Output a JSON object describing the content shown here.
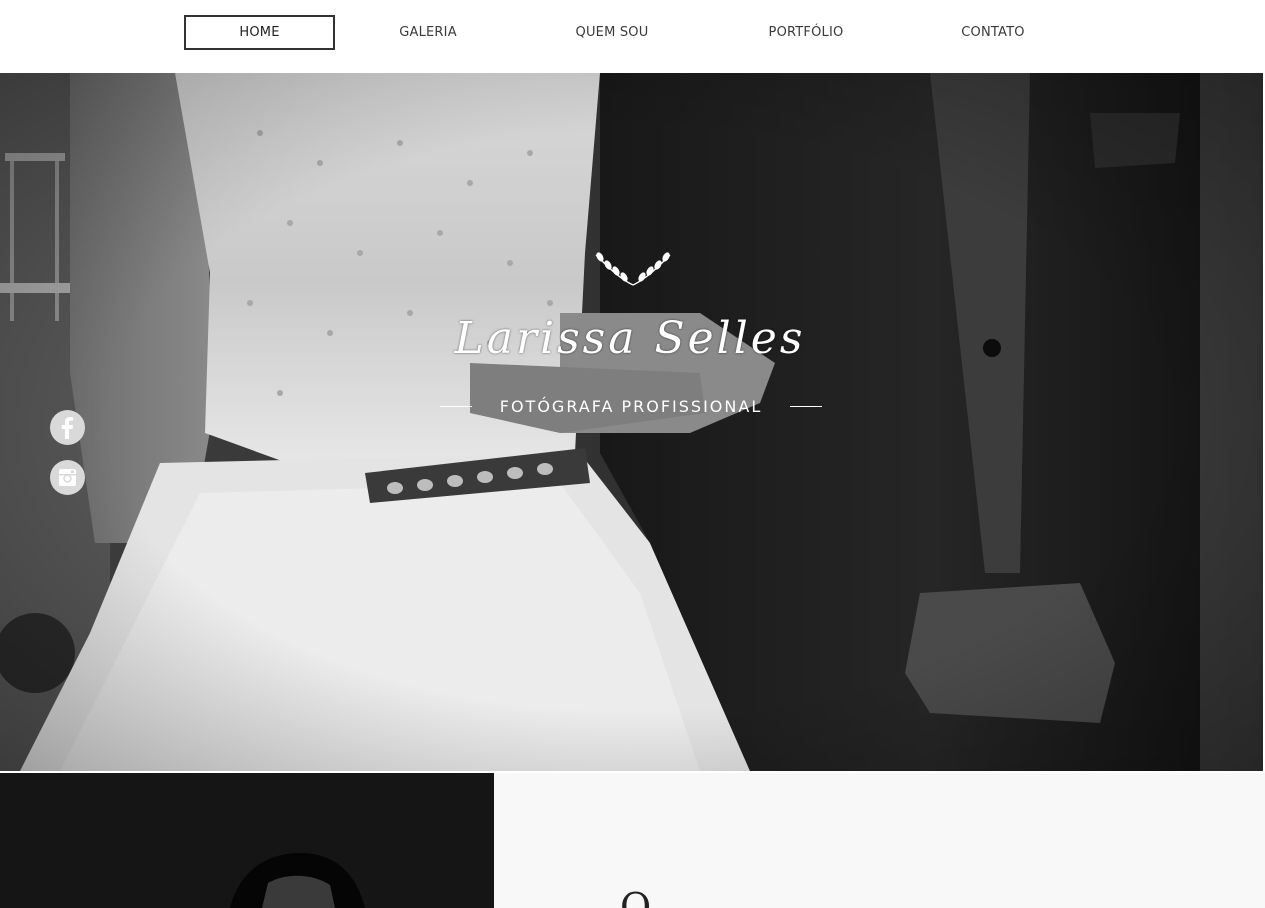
{
  "nav": {
    "items": [
      {
        "label": "HOME",
        "active": true
      },
      {
        "label": "GALERIA",
        "active": false
      },
      {
        "label": "QUEM SOU",
        "active": false
      },
      {
        "label": "PORTFÓLIO",
        "active": false
      },
      {
        "label": "CONTATO",
        "active": false
      }
    ]
  },
  "hero": {
    "title": "Larissa Selles",
    "subtitle": "FOTÓGRAFA PROFISSIONAL",
    "ornament_icon": "laurel-branch-icon"
  },
  "social": {
    "facebook_icon": "facebook-icon",
    "instagram_icon": "instagram-icon"
  },
  "about": {
    "heading_partial": "Q"
  },
  "colors": {
    "text_dark": "#3a3a3a",
    "active_border": "#333333",
    "white": "#ffffff",
    "social_bg": "#d9d9d9",
    "panel_bg": "#f8f8f8"
  }
}
